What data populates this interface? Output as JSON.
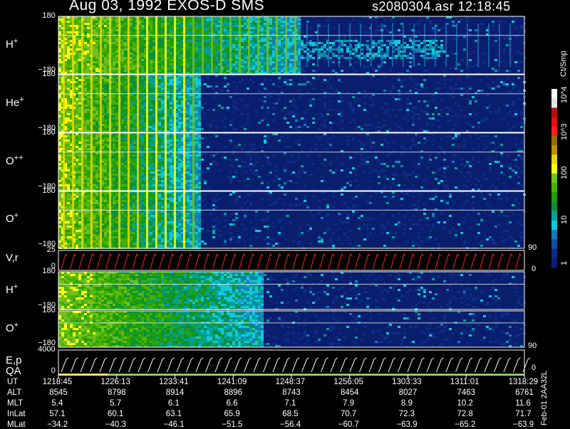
{
  "header": {
    "title": "Aug 03, 1992   EXOS-D SMS",
    "file_time": "s2080304.asr  12:18:45"
  },
  "chart_data": {
    "type": "heatmap",
    "panels": [
      {
        "label": "H",
        "sup": "+",
        "ymax": "180",
        "ymin": "−180"
      },
      {
        "label": "He",
        "sup": "+",
        "ymax": "180",
        "ymin": "−180"
      },
      {
        "label": "O",
        "sup": "++",
        "ymax": "180",
        "ymin": "−180"
      },
      {
        "label": "O",
        "sup": "+",
        "ymax": "180",
        "ymin": "−180"
      },
      {
        "label": "V,r",
        "sup": "",
        "ymax": "25",
        "ymin": "0"
      },
      {
        "label": "H",
        "sup": "+",
        "ymax": "180",
        "ymin": "−180"
      },
      {
        "label": "O",
        "sup": "+",
        "ymax": "180",
        "ymin": "−180"
      },
      {
        "label": "E,p",
        "sub_label": "QA",
        "ymax": "4000",
        "ymin": "0"
      }
    ],
    "right_ticks": {
      "vr_top": "90",
      "vr_bottom": "0",
      "ep_top": "90",
      "ep_bottom": "0"
    },
    "colorbar": {
      "unit": "Ct/Smp",
      "labels": [
        "10^4",
        "10^3",
        "100",
        "10",
        "1"
      ],
      "colors": [
        "#ffffff",
        "#e4e4e4",
        "#b01018",
        "#e01010",
        "#ff2020",
        "#907000",
        "#b89000",
        "#e6d800",
        "#ffff10",
        "#70c020",
        "#48b000",
        "#20a000",
        "#089040",
        "#00a0a0",
        "#10c8d8",
        "#1878b8",
        "#104fa0",
        "#0c2e86",
        "#0a1e6e"
      ]
    },
    "time_axis": {
      "UT": [
        "1218:45",
        "1226:13",
        "1233:41",
        "1241:09",
        "1248:37",
        "1256:05",
        "1303:33",
        "1311:01",
        "1318:29"
      ],
      "ALT": [
        "8545",
        "8798",
        "8914",
        "8896",
        "8743",
        "8454",
        "8027",
        "7463",
        "6761"
      ],
      "MLT": [
        "5.4",
        "5.7",
        "6.1",
        "6.6",
        "7.1",
        "7.9",
        "8.9",
        "10.2",
        "11.6"
      ],
      "InLat": [
        "57.1",
        "60.1",
        "63.1",
        "65.9",
        "68.5",
        "70.7",
        "72.3",
        "72.8",
        "71.7"
      ],
      "MLat": [
        "−34.2",
        "−40.3",
        "−46.1",
        "−51.5",
        "−56.4",
        "−60.7",
        "−63.9",
        "−65.2",
        "−63.9"
      ]
    },
    "row_labels": [
      "UT",
      "ALT",
      "MLT",
      "InLat",
      "MLat"
    ],
    "footer_vertical": "Feb-01 2AA32L"
  }
}
